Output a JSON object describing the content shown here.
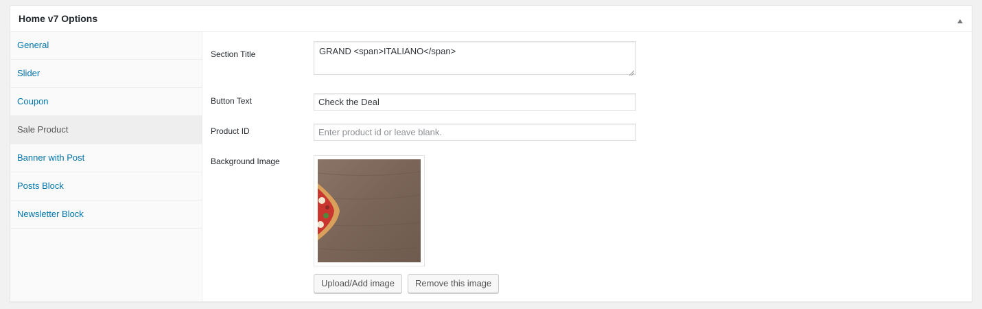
{
  "postbox": {
    "title": "Home v7 Options"
  },
  "tabs": [
    {
      "label": "General",
      "active": false
    },
    {
      "label": "Slider",
      "active": false
    },
    {
      "label": "Coupon",
      "active": false
    },
    {
      "label": "Sale Product",
      "active": true
    },
    {
      "label": "Banner with Post",
      "active": false
    },
    {
      "label": "Posts Block",
      "active": false
    },
    {
      "label": "Newsletter Block",
      "active": false
    }
  ],
  "fields": {
    "section_title": {
      "label": "Section Title",
      "value": "GRAND <span>ITALIANO</span>"
    },
    "button_text": {
      "label": "Button Text",
      "value": "Check the Deal"
    },
    "product_id": {
      "label": "Product ID",
      "value": "",
      "placeholder": "Enter product id or leave blank."
    },
    "background_image": {
      "label": "Background Image",
      "upload_label": "Upload/Add image",
      "remove_label": "Remove this image"
    }
  },
  "colors": {
    "link": "#0073aa",
    "active_tab_bg": "#eeeeee",
    "page_bg": "#f1f1f1"
  },
  "icons": {
    "collapse": "triangle-up-icon",
    "resize": "resize-grip-icon"
  }
}
